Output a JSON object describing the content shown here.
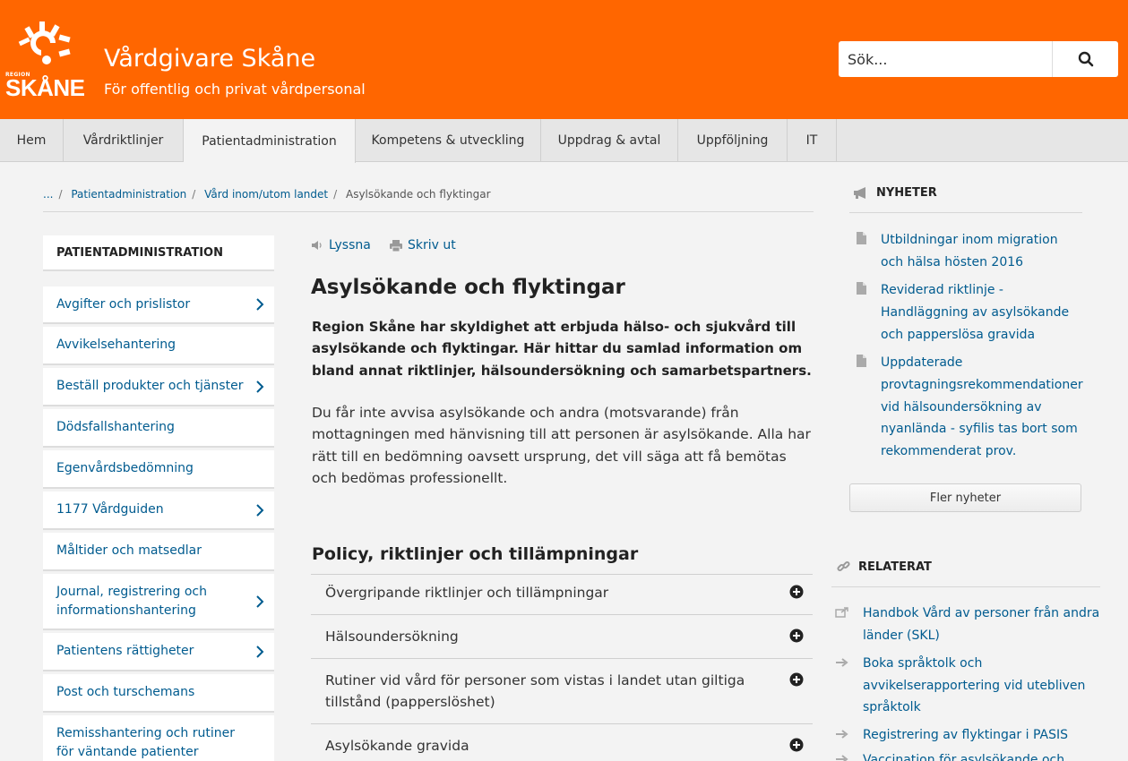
{
  "header": {
    "logo_region": "REGION",
    "logo_name": "SKÅNE",
    "title": "Vårdgivare Skåne",
    "subtitle": "För offentlig och privat vårdpersonal",
    "search_placeholder": "Sök...",
    "brand_color": "#ff6600"
  },
  "nav": {
    "items": [
      {
        "label": "Hem"
      },
      {
        "label": "Vårdriktlinjer"
      },
      {
        "label": "Patientadministration",
        "active": true
      },
      {
        "label": "Kompetens & utveckling"
      },
      {
        "label": "Uppdrag & avtal"
      },
      {
        "label": "Uppföljning"
      },
      {
        "label": "IT"
      }
    ]
  },
  "breadcrumb": {
    "ellipsis": "...",
    "items": [
      "Patientadministration",
      "Vård inom/utom landet"
    ],
    "current": "Asylsökande och flyktingar"
  },
  "sidebar": {
    "title": "PATIENTADMINISTRATION",
    "items": [
      {
        "label": "Avgifter och prislistor",
        "has_children": true
      },
      {
        "label": "Avvikelsehantering",
        "has_children": false
      },
      {
        "label": "Beställ produkter och tjänster",
        "has_children": true
      },
      {
        "label": "Dödsfallshantering",
        "has_children": false
      },
      {
        "label": "Egenvårdsbedömning",
        "has_children": false
      },
      {
        "label": "1177 Vårdguiden",
        "has_children": true
      },
      {
        "label": "Måltider och matsedlar",
        "has_children": false
      },
      {
        "label": "Journal, registrering och informationshantering",
        "has_children": true
      },
      {
        "label": "Patientens rättigheter",
        "has_children": true
      },
      {
        "label": "Post och turschemans",
        "has_children": false
      },
      {
        "label": "Remisshantering och rutiner för väntande patienter",
        "has_children": false
      }
    ]
  },
  "tools": {
    "listen": "Lyssna",
    "print": "Skriv ut"
  },
  "main": {
    "title": "Asylsökande och flyktingar",
    "lead": "Region Skåne har skyldighet att erbjuda hälso- och sjukvård till asylsökande och flyktingar. Här hittar du samlad information om bland annat riktlinjer, hälsoundersökning och samarbetspartners.",
    "body": "Du får inte avvisa asylsökande och andra (motsvarande) från mottagningen med hänvisning till att personen är asylsökande. Alla har rätt till en bedömning oavsett ursprung, det vill säga att få bemötas och bedömas professionellt.",
    "section_title": "Policy, riktlinjer och tillämpningar",
    "accordion": [
      "Övergripande riktlinjer och tillämpningar",
      "Hälsoundersökning",
      "Rutiner vid vård för personer som vistas i landet utan giltiga tillstånd (papperslöshet)",
      "Asylsökande gravida"
    ]
  },
  "news": {
    "title": "NYHETER",
    "items": [
      "Utbildningar inom migration och hälsa hösten 2016",
      "Reviderad riktlinje - Handläggning av asylsökande och papperslösa gravida",
      "Uppdaterade provtagningsrekommendationer vid hälsoundersökning av nyanlända - syfilis tas bort som rekommenderat prov."
    ],
    "more_label": "Fler nyheter"
  },
  "related": {
    "title": "RELATERAT",
    "items": [
      {
        "label": "Handbok Vård av personer från andra länder (SKL)",
        "icon": "external-link-icon"
      },
      {
        "label": "Boka språktolk och avvikelserapportering vid utebliven språktolk",
        "icon": "arrow-right-icon"
      },
      {
        "label": "Registrering av flyktingar i PASIS",
        "icon": "arrow-right-icon"
      },
      {
        "label": "Vaccination för asylsökande och",
        "icon": "arrow-right-icon"
      }
    ]
  }
}
